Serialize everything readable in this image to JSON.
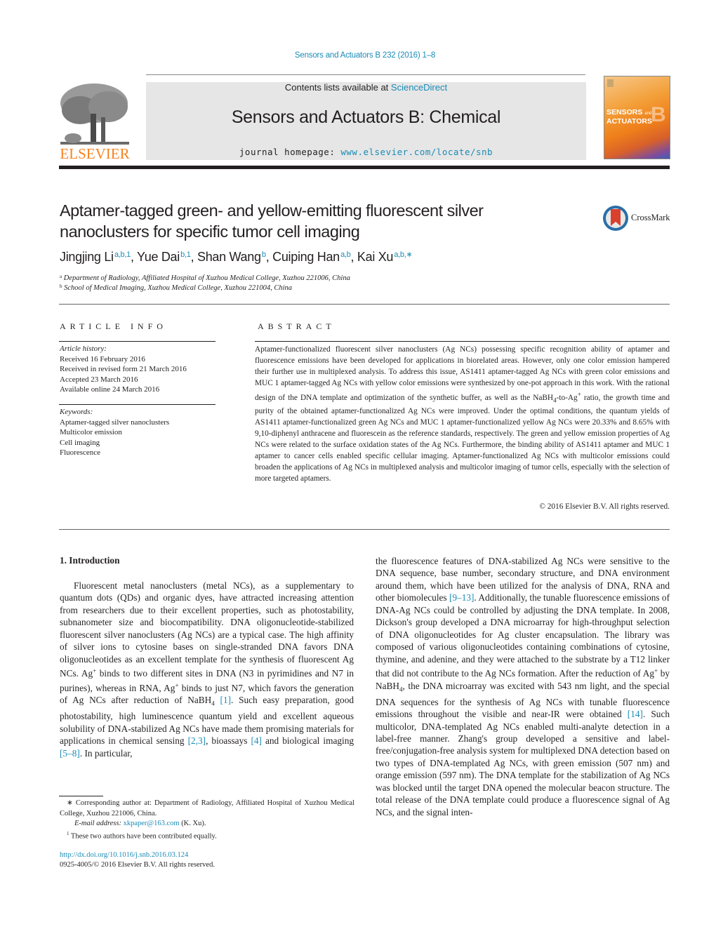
{
  "header": {
    "citation": "Sensors and Actuators B 232 (2016) 1–8",
    "contents_prefix": "Contents lists available at ",
    "contents_link": "ScienceDirect",
    "journal_title": "Sensors and Actuators B: Chemical",
    "homepage_prefix": "journal homepage: ",
    "homepage_link": "www.elsevier.com/locate/snb",
    "publisher_logo": "ELSEVIER",
    "cover_title_line1": "SENSORS",
    "cover_title_and": "and",
    "cover_title_line2": "ACTUATORS",
    "cover_letter": "B"
  },
  "article": {
    "title": "Aptamer-tagged green- and yellow-emitting fluorescent silver nanoclusters for specific tumor cell imaging",
    "crossmark_label": "CrossMark",
    "authors": [
      {
        "name": "Jingjing Li",
        "sup": "a,b,1"
      },
      {
        "name": "Yue Dai",
        "sup": "b,1"
      },
      {
        "name": "Shan Wang",
        "sup": "b"
      },
      {
        "name": "Cuiping Han",
        "sup": "a,b"
      },
      {
        "name": "Kai Xu",
        "sup": "a,b,∗"
      }
    ],
    "affiliations": [
      {
        "mark": "a",
        "text": "Department of Radiology, Affiliated Hospital of Xuzhou Medical College, Xuzhou 221006, China"
      },
      {
        "mark": "b",
        "text": "School of Medical Imaging, Xuzhou Medical College, Xuzhou 221004, China"
      }
    ]
  },
  "article_info": {
    "heading": "ARTICLE INFO",
    "history_label": "Article history:",
    "history": [
      "Received 16 February 2016",
      "Received in revised form 21 March 2016",
      "Accepted 23 March 2016",
      "Available online 24 March 2016"
    ],
    "keywords_label": "Keywords:",
    "keywords": [
      "Aptamer-tagged silver nanoclusters",
      "Multicolor emission",
      "Cell imaging",
      "Fluorescence"
    ]
  },
  "abstract": {
    "heading": "ABSTRACT",
    "text_part1": "Aptamer-functionalized fluorescent silver nanoclusters (Ag NCs) possessing specific recognition ability of aptamer and fluorescence emissions have been developed for applications in biorelated areas. However, only one color emission hampered their further use in multiplexed analysis. To address this issue, AS1411 aptamer-tagged Ag NCs with green color emissions and MUC 1 aptamer-tagged Ag NCs with yellow color emissions were synthesized by one-pot approach in this work. With the rational design of the DNA template and optimization of the synthetic buffer, as well as the NaBH",
    "text_sub": "4",
    "text_part2": "-to-Ag",
    "text_sup": "+",
    "text_part3": " ratio, the growth time and purity of the obtained aptamer-functionalized Ag NCs were improved. Under the optimal conditions, the quantum yields of AS1411 aptamer-functionalized green Ag NCs and MUC 1 aptamer-functionalized yellow Ag NCs were 20.33% and 8.65% with 9,10-diphenyl anthracene and fluorescein as the reference standards, respectively. The green and yellow emission properties of Ag NCs were related to the surface oxidation states of the Ag NCs. Furthermore, the binding ability of AS1411 aptamer and MUC 1 aptamer to cancer cells enabled specific cellular imaging. Aptamer-functionalized Ag NCs with multicolor emissions could broaden the applications of Ag NCs in multiplexed analysis and multicolor imaging of tumor cells, especially with the selection of more targeted aptamers.",
    "copyright": "© 2016 Elsevier B.V. All rights reserved."
  },
  "introduction": {
    "heading": "1.  Introduction",
    "left": {
      "s1": "Fluorescent metal nanoclusters (metal NCs), as a supplementary to quantum dots (QDs) and organic dyes, have attracted increasing attention from researchers due to their excellent properties, such as photostability, subnanometer size and biocompatibility. DNA oligonucleotide-stabilized fluorescent silver nanoclusters (Ag NCs) are a typical case. The high affinity of silver ions to cytosine bases on single-stranded DNA favors DNA oligonucleotides as an excellent template for the synthesis of fluorescent Ag NCs. Ag",
      "s2": " binds to two different sites in DNA (N3 in pyrimidines and N7 in purines), whereas in RNA, Ag",
      "s3": " binds to just N7, which favors the generation of Ag NCs after reduction of NaBH",
      "s4": " ",
      "ref1": "[1]",
      "s5": ". Such easy preparation, good photostability, high luminescence quantum yield and excellent aqueous solubility of DNA-stabilized Ag NCs have made them promising materials for applications in chemical sensing ",
      "ref2": "[2,3]",
      "s6": ", bioassays ",
      "ref3": "[4]",
      "s7": " and biological imaging ",
      "ref4": "[5–8]",
      "s8": ". In particular,",
      "sup_plus": "+",
      "sub_4": "4"
    },
    "right": {
      "s1": "the fluorescence features of DNA-stabilized Ag NCs were sensitive to the DNA sequence, base number, secondary structure, and DNA environment around them, which have been utilized for the analysis of DNA, RNA and other biomolecules ",
      "ref1": "[9–13]",
      "s2": ". Additionally, the tunable fluorescence emissions of DNA-Ag NCs could be controlled by adjusting the DNA template. In 2008, Dickson's group developed a DNA microarray for high-throughput selection of DNA oligonucleotides for Ag cluster encapsulation. The library was composed of various oligonucleotides containing combinations of cytosine, thymine, and adenine, and they were attached to the substrate by a T12 linker that did not contribute to the Ag NCs formation. After the reduction of Ag",
      "s3": " by NaBH",
      "s4": ", the DNA microarray was excited with 543 nm light, and the special DNA sequences for the synthesis of Ag NCs with tunable fluorescence emissions throughout the visible and near-IR were obtained ",
      "ref2": "[14]",
      "s5": ". Such multicolor, DNA-templated Ag NCs enabled multi-analyte detection in a label-free manner. Zhang's group developed a sensitive and label-free/conjugation-free analysis system for multiplexed DNA detection based on two types of DNA-templated Ag NCs, with green emission (507 nm) and orange emission (597 nm). The DNA template for the stabilization of Ag NCs was blocked until the target DNA opened the molecular beacon structure. The total release of the DNA template could produce a fluorescence signal of Ag NCs, and the signal inten-",
      "sup_plus": "+",
      "sub_4": "4"
    }
  },
  "footnotes": {
    "corresponding": "∗  Corresponding author at: Department of Radiology, Affiliated Hospital of Xuzhou Medical College, Xuzhou 221006, China.",
    "email_label": "E-mail address: ",
    "email": "xkpaper@163.com",
    "email_suffix": " (K. Xu).",
    "equal_mark": "1",
    "equal": "  These two authors have been contributed equally.",
    "doi": "http://dx.doi.org/10.1016/j.snb.2016.03.124",
    "issn": "0925-4005/© 2016 Elsevier B.V. All rights reserved."
  },
  "colors": {
    "link": "#1a8bb5",
    "elsevier_orange": "#f58220",
    "banner_gray": "#e6e6e6",
    "text": "#231f20"
  }
}
